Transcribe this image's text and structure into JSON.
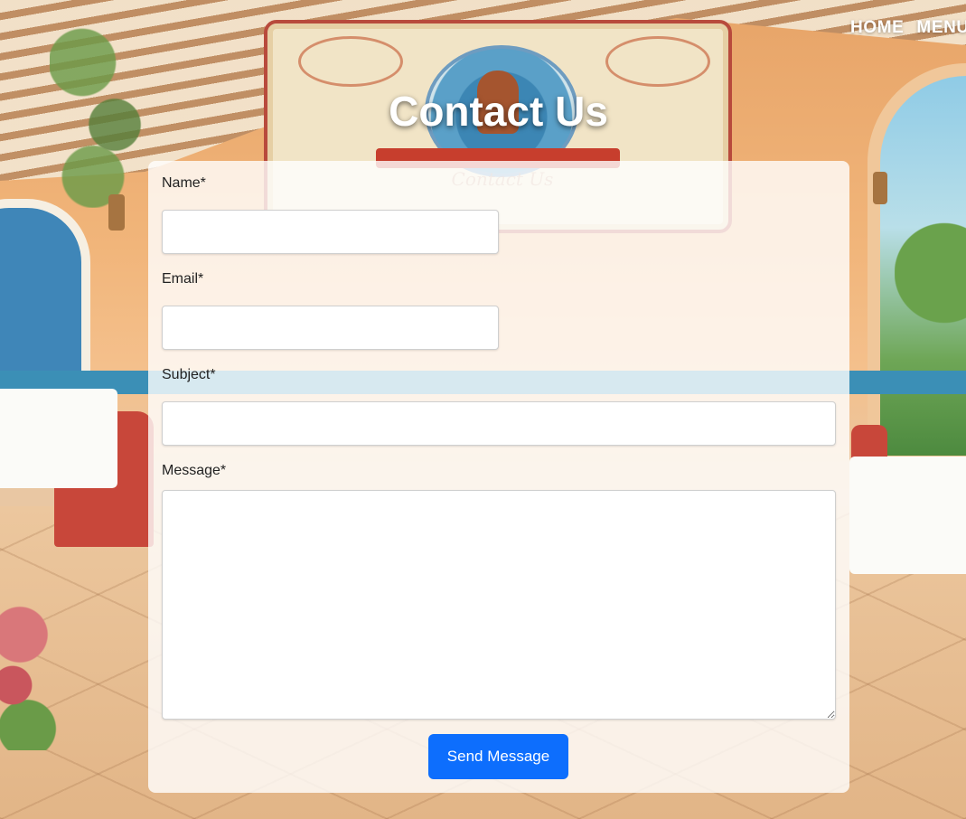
{
  "nav": {
    "items": [
      {
        "label": "HOME"
      },
      {
        "label": "MENU"
      }
    ]
  },
  "page": {
    "title": "Contact Us"
  },
  "form": {
    "name_label": "Name*",
    "name_value": "",
    "email_label": "Email*",
    "email_value": "",
    "subject_label": "Subject*",
    "subject_value": "",
    "message_label": "Message*",
    "message_value": "",
    "submit_label": "Send Message"
  },
  "colors": {
    "primary_button": "#0d6efd",
    "title_text": "#ffffff",
    "card_background": "rgba(255,255,255,0.8)"
  },
  "icons": {
    "background": "restaurant-illustration",
    "sign": "contact-us-sign-illustration"
  }
}
